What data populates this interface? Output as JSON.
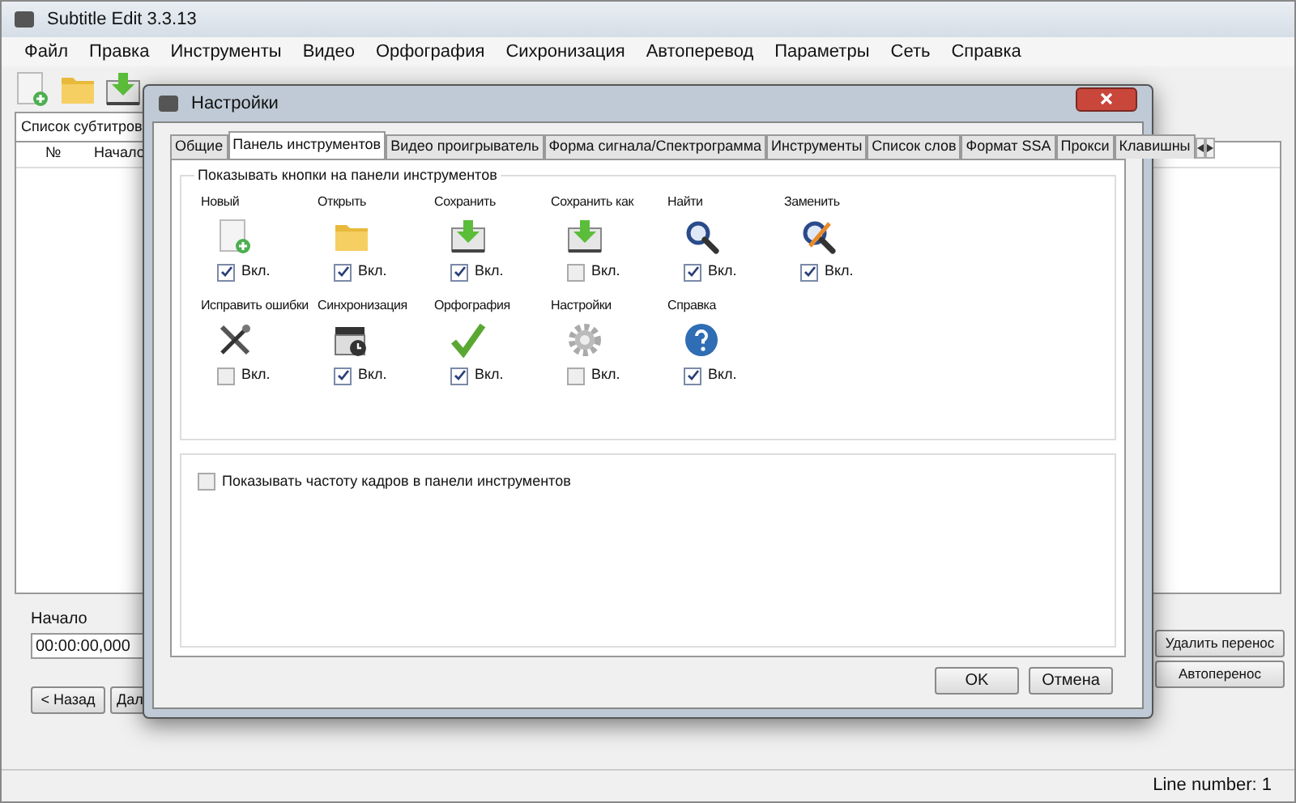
{
  "window": {
    "title": "Subtitle Edit 3.3.13"
  },
  "menu": [
    "Файл",
    "Правка",
    "Инструменты",
    "Видео",
    "Орфография",
    "Сихронизация",
    "Автоперевод",
    "Параметры",
    "Сеть",
    "Справка"
  ],
  "main_tab": {
    "label": "Список субтитров",
    "selected": true
  },
  "table": {
    "columns": [
      "№",
      "Начало"
    ]
  },
  "start_label": "Начало",
  "start_time": "00:00:00,000",
  "nav_buttons": [
    "< Назад",
    "Дал"
  ],
  "side_buttons": [
    "Удалить перенос",
    "Автоперенос"
  ],
  "status_bar": "Line number: 1",
  "dialog": {
    "title": "Настройки",
    "tabs": [
      {
        "label": "Общие",
        "selected": false
      },
      {
        "label": "Панель инструментов",
        "selected": true
      },
      {
        "label": "Видео проигрыватель",
        "selected": false
      },
      {
        "label": "Форма сигнала/Спектрограмма",
        "selected": false
      },
      {
        "label": "Инструменты",
        "selected": false
      },
      {
        "label": "Список слов",
        "selected": false
      },
      {
        "label": "Формат SSA",
        "selected": false
      },
      {
        "label": "Прокси",
        "selected": false
      },
      {
        "label": "Клавишны",
        "selected": false
      }
    ],
    "group_title": "Показывать кнопки на панели инструментов",
    "rows": [
      [
        {
          "label": "Новый",
          "kind": "new",
          "checked": true,
          "check_label": "Вкл."
        },
        {
          "label": "Открыть",
          "kind": "open",
          "checked": true,
          "check_label": "Вкл."
        },
        {
          "label": "Сохранить",
          "kind": "save",
          "checked": true,
          "check_label": "Вкл."
        },
        {
          "label": "Сохранить как",
          "kind": "save",
          "checked": false,
          "check_label": "Вкл."
        },
        {
          "label": "Найти",
          "kind": "find",
          "checked": true,
          "check_label": "Вкл."
        },
        {
          "label": "Заменить",
          "kind": "replace",
          "checked": true,
          "check_label": "Вкл."
        }
      ],
      [
        {
          "label": "Исправить ошибки",
          "kind": "fix",
          "checked": false,
          "check_label": "Вкл."
        },
        {
          "label": "Синхронизация",
          "kind": "sync",
          "checked": true,
          "check_label": "Вкл."
        },
        {
          "label": "Орфография",
          "kind": "spell",
          "checked": true,
          "check_label": "Вкл."
        },
        {
          "label": "Настройки",
          "kind": "settings",
          "checked": false,
          "check_label": "Вкл."
        },
        {
          "label": "Справка",
          "kind": "help",
          "checked": true,
          "check_label": "Вкл."
        }
      ]
    ],
    "frame_rate": {
      "label": "Показывать частоту кадров в панели инструментов",
      "checked": false
    },
    "buttons": [
      "OK",
      "Отмена"
    ]
  }
}
